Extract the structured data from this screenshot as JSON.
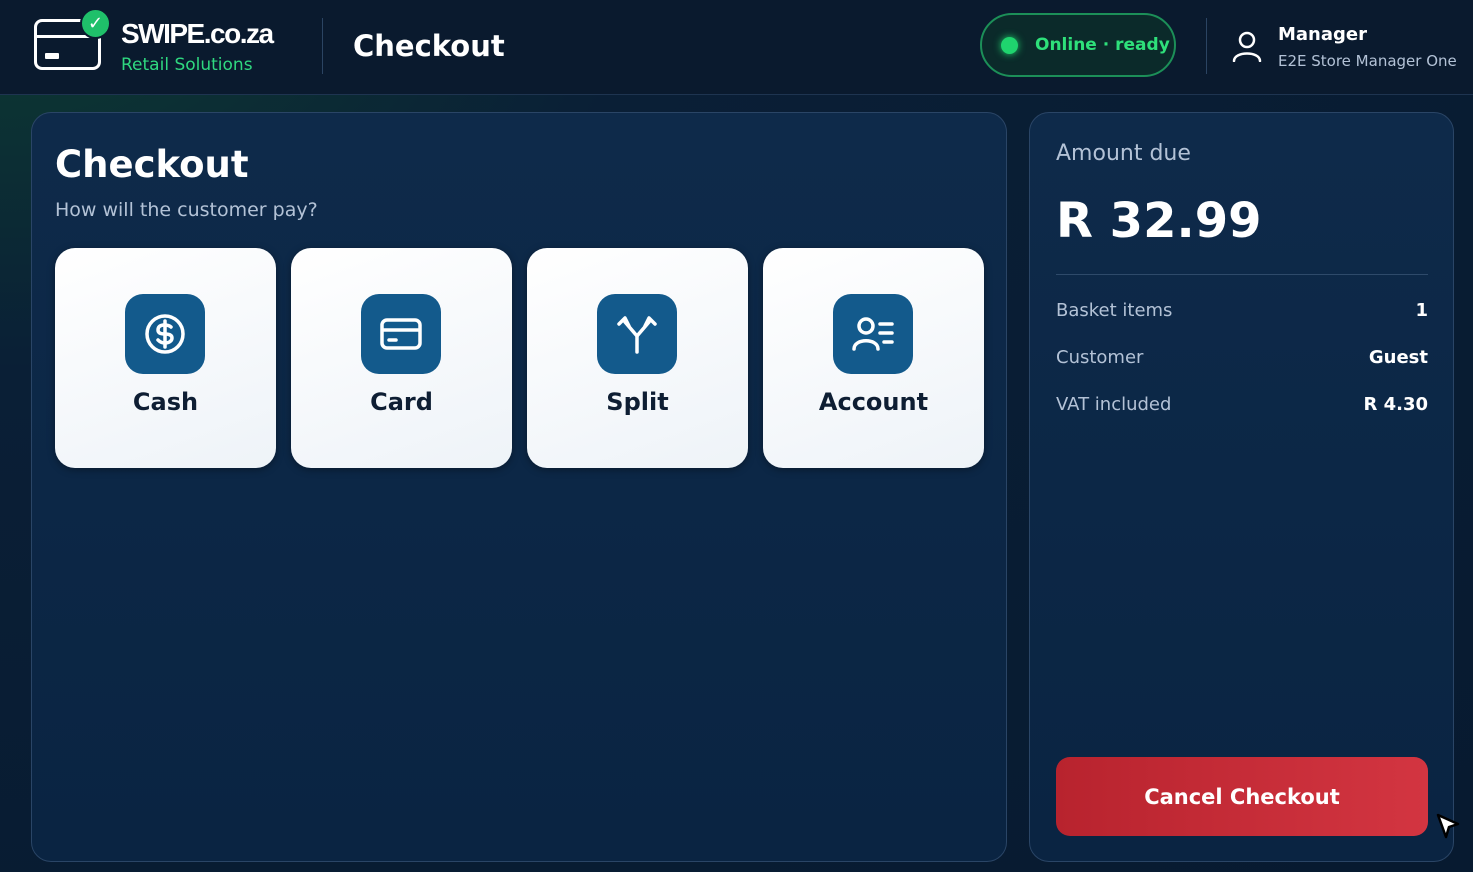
{
  "header": {
    "brand_name": "SWIPE.co.za",
    "brand_sub": "Retail Solutions",
    "page_title": "Checkout",
    "status": "Online · ready",
    "user_role": "Manager",
    "user_name": "E2E Store Manager One"
  },
  "checkout": {
    "title": "Checkout",
    "subtitle": "How will the customer pay?",
    "methods": [
      {
        "label": "Cash",
        "icon": "dollar-circle-icon"
      },
      {
        "label": "Card",
        "icon": "credit-card-icon"
      },
      {
        "label": "Split",
        "icon": "split-arrows-icon"
      },
      {
        "label": "Account",
        "icon": "user-list-icon"
      }
    ]
  },
  "summary": {
    "amount_label": "Amount due",
    "amount_value": "R 32.99",
    "rows": [
      {
        "key": "Basket items",
        "value": "1"
      },
      {
        "key": "Customer",
        "value": "Guest"
      },
      {
        "key": "VAT included",
        "value": "R 4.30"
      }
    ],
    "cancel_label": "Cancel Checkout"
  },
  "colors": {
    "accent_green": "#2ee07a",
    "button_blue": "#135a8c",
    "cancel_red": "#c62a36"
  }
}
